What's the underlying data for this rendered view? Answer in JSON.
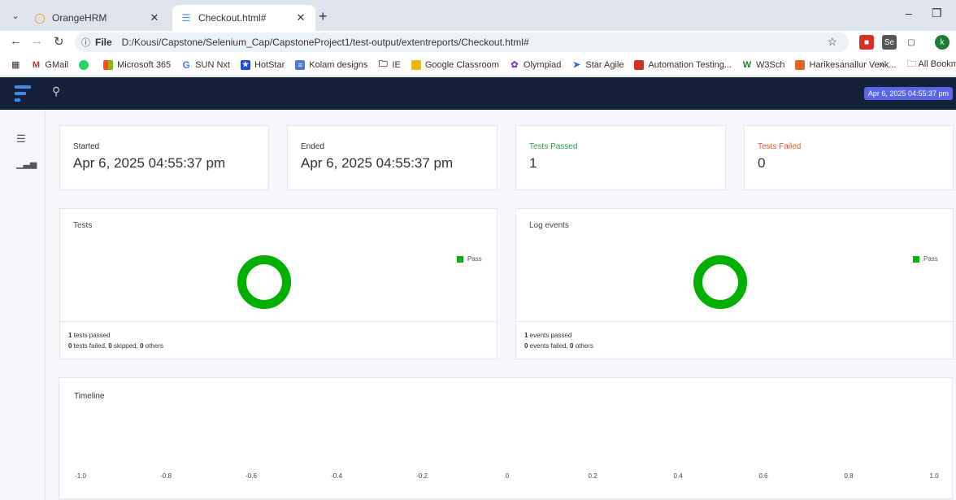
{
  "browser": {
    "tabs": [
      {
        "title": "OrangeHRM",
        "active": false
      },
      {
        "title": "Checkout.html#",
        "active": true
      }
    ],
    "new_tab": "+",
    "address": {
      "prefix": "File",
      "url": "D:/Kousi/Capstone/Selenium_Cap/CapstoneProject1/test-output/extentreports/Checkout.html#"
    },
    "bookmarks": [
      "GMail",
      "Microsoft 365",
      "SUN Nxt",
      "HotStar",
      "Kolam designs",
      "IE",
      "Google Classroom",
      "Olympiad",
      "Star Agile",
      "Automation Testing...",
      "W3Sch",
      "Harikesanallur Venk..."
    ],
    "bookmarks_overflow": "»",
    "all_bookmarks": "All Bookm",
    "profile_initial": "k"
  },
  "app": {
    "date_badge": "Apr 6, 2025 04:55:37 pm"
  },
  "stats": {
    "started": {
      "label": "Started",
      "value": "Apr 6, 2025 04:55:37 pm"
    },
    "ended": {
      "label": "Ended",
      "value": "Apr 6, 2025 04:55:37 pm"
    },
    "passed": {
      "label": "Tests Passed",
      "value": "1",
      "color": "#2ea043"
    },
    "failed": {
      "label": "Tests Failed",
      "value": "0",
      "color": "#e05a2b"
    }
  },
  "tests_chart": {
    "title": "Tests",
    "legend": "Pass",
    "pass_fraction": 1.0,
    "summary": {
      "passed_count": "1",
      "passed_text": " tests passed",
      "failed_count": "0",
      "failed_text": " tests failed, ",
      "skipped_count": "0",
      "skipped_text": " skipped, ",
      "others_count": "0",
      "others_text": " others"
    }
  },
  "log_chart": {
    "title": "Log events",
    "legend": "Pass",
    "pass_fraction": 1.0,
    "summary": {
      "passed_count": "1",
      "passed_text": " events passed",
      "failed_count": "0",
      "failed_text": " events failed, ",
      "others_count": "0",
      "others_text": " others"
    }
  },
  "timeline": {
    "title": "Timeline",
    "ticks": [
      "-1.0",
      "-0.8",
      "-0.6",
      "-0.4",
      "-0.2",
      "0",
      "0.2",
      "0.4",
      "0.6",
      "0.8",
      "1.0"
    ]
  }
}
